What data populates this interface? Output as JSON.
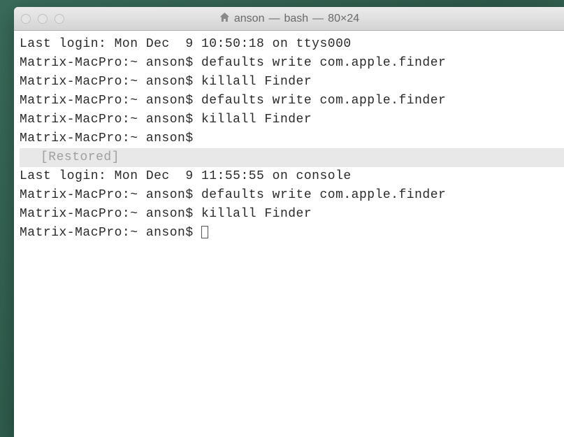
{
  "window": {
    "title_user": "anson",
    "title_shell": "bash",
    "title_size": "80×24"
  },
  "lines": [
    {
      "text": "Last login: Mon Dec  9 10:50:18 on ttys000",
      "restored": false
    },
    {
      "text": "Matrix-MacPro:~ anson$ defaults write com.apple.finder ",
      "restored": false
    },
    {
      "text": "Matrix-MacPro:~ anson$ killall Finder",
      "restored": false
    },
    {
      "text": "Matrix-MacPro:~ anson$ defaults write com.apple.finder ",
      "restored": false
    },
    {
      "text": "Matrix-MacPro:~ anson$ killall Finder",
      "restored": false
    },
    {
      "text": "Matrix-MacPro:~ anson$ ",
      "restored": false
    },
    {
      "text": "[Restored]",
      "restored": true
    },
    {
      "text": "Last login: Mon Dec  9 11:55:55 on console",
      "restored": false
    },
    {
      "text": "Matrix-MacPro:~ anson$ defaults write com.apple.finder ",
      "restored": false
    },
    {
      "text": "Matrix-MacPro:~ anson$ killall Finder",
      "restored": false
    }
  ],
  "prompt": {
    "text": "Matrix-MacPro:~ anson$ "
  }
}
